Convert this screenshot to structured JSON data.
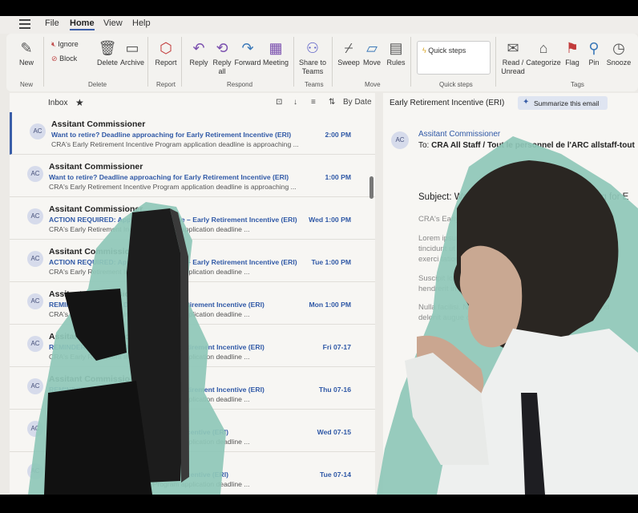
{
  "menu": {
    "tabs": [
      "File",
      "Home",
      "View",
      "Help"
    ]
  },
  "ribbon": {
    "new": "New",
    "ignore": "Ignore",
    "block": "Block",
    "delete": "Delete",
    "archive": "Archive",
    "report": "Report",
    "reply": "Reply",
    "reply_all_1": "Reply",
    "reply_all_2": "all",
    "forward": "Forward",
    "meeting": "Meeting",
    "share_1": "Share to",
    "share_2": "Teams",
    "sweep": "Sweep",
    "move": "Move",
    "rules": "Rules",
    "quick_steps": "Quick steps",
    "read_unread_1": "Read /",
    "read_unread_2": "Unread",
    "categorize": "Categorize",
    "flag": "Flag",
    "pin": "Pin",
    "snooze": "Snooze",
    "groups": {
      "new": "New",
      "delete": "Delete",
      "report": "Report",
      "respond": "Respond",
      "teams": "Teams",
      "move": "Move",
      "quick_steps": "Quick steps",
      "tags": "Tags"
    }
  },
  "list": {
    "folder": "Inbox",
    "sort": "By Date",
    "emails": [
      {
        "initials": "AC",
        "sender": "Assitant Commissioner",
        "subject": "Want to retire? Deadline approaching for Early Retirement Incentive (ERI)",
        "time": "2:00 PM",
        "preview": "CRA's Early Retirement Incentive Program application deadline is approaching ..."
      },
      {
        "initials": "AC",
        "sender": "Assitant Commissioner",
        "subject": "Want to retire? Deadline approaching for Early Retirement Incentive (ERI)",
        "time": "1:00 PM",
        "preview": "CRA's Early Retirement Incentive Program application deadline is approaching ..."
      },
      {
        "initials": "AC",
        "sender": "Assitant Commissioner",
        "subject": "ACTION REQUIRED: Application deadline – Early Retirement Incentive (ERI)",
        "time": "Wed 1:00 PM",
        "preview": "CRA's Early Retirement Incentive Program application deadline ..."
      },
      {
        "initials": "AC",
        "sender": "Assitant Commissioner",
        "subject": "ACTION REQUIRED: Application deadline – Early Retirement Incentive (ERI)",
        "time": "Tue 1:00 PM",
        "preview": "CRA's Early Retirement Incentive Program application deadline ..."
      },
      {
        "initials": "AC",
        "sender": "Assitant Commissioner",
        "subject": "REMINDER / RAPPEL: Deadline – Early Retirement Incentive (ERI)",
        "time": "Mon 1:00 PM",
        "preview": "CRA's Early Retirement Incentive Program application deadline ..."
      },
      {
        "initials": "AC",
        "sender": "Assitant Commissioner",
        "subject": "REMINDER / RAPPEL: Deadline – Early Retirement Incentive (ERI)",
        "time": "Fri 07-17",
        "preview": "CRA's Early Retirement Incentive Program application deadline ..."
      },
      {
        "initials": "AC",
        "sender": "Assitant Commissioner",
        "subject": "REMINDER / RAPPEL: Deadline – Early Retirement Incentive (ERI)",
        "time": "Thu 07-16",
        "preview": "CRA's Early Retirement Incentive Program application deadline ..."
      },
      {
        "initials": "AC",
        "sender": "Assitant Commissioner",
        "subject": "Application deadline – Early Retirement Incentive (ERI)",
        "time": "Wed 07-15",
        "preview": "CRA's Early Retirement Incentive Program application deadline ..."
      },
      {
        "initials": "AC",
        "sender": "Assitant Commissioner",
        "subject": "Application deadline – Early Retirement Incentive (ERI)",
        "time": "Tue 07-14",
        "preview": "CRA's Early Retirement Incentive Program application deadline ..."
      }
    ]
  },
  "reading": {
    "title": "Early Retirement Incentive (ERI)",
    "summarize": "Summarize this email",
    "initials": "AC",
    "from": "Assitant Commissioner",
    "to_label": "To:",
    "to": "CRA All Staff / Tout le personnel de l'ARC allstaff-tout",
    "subject": "Subject: Want to retire? Deadline approaching for E",
    "lines": [
      "CRA's Early Retirement Incentive ...",
      "Lorem ipsum dolor sit amet, consectetur adipiscing elit,",
      "tincidunt ut laoreet dolore magna aliquam erat volutpat. U",
      "exerci tation ullamcorper suscipit lobortis nisl ut aliquip",
      "Suscipit lobortis nisl ut aliquip ex ea commodo consequat",
      "hendrerit in vulputate velit esse molestie consequat, vel ill",
      "Nulla facilisi. Nam liber tempor cum soluta nobis eleifend",
      "delenit augue duis dolore te feugait nulla facilisi."
    ]
  },
  "colors": {
    "accent": "#2f58a6",
    "teal": "#8fc7b8"
  }
}
